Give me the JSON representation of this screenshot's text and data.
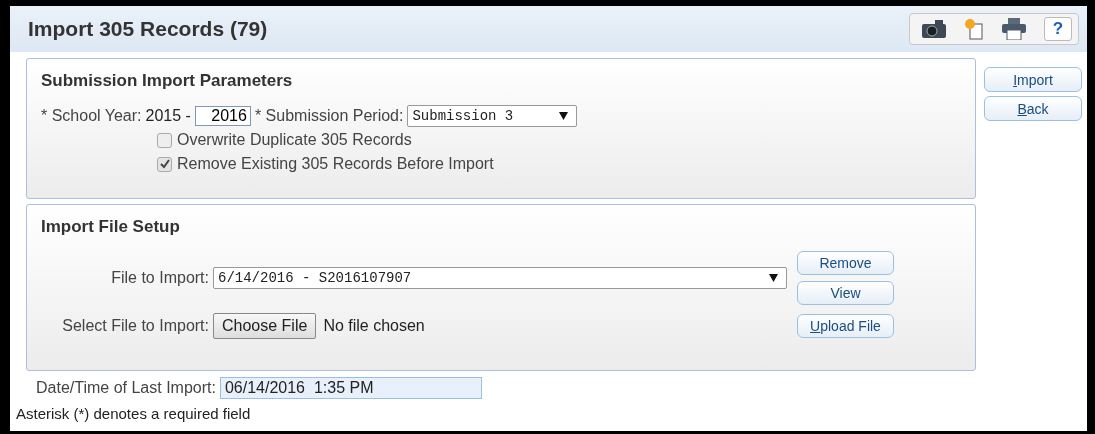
{
  "window": {
    "title": "Import 305 Records (79)"
  },
  "toolbar": [
    {
      "kind": "camera"
    },
    {
      "kind": "copy"
    },
    {
      "kind": "print"
    },
    {
      "kind": "help",
      "label": "?"
    }
  ],
  "actions": [
    {
      "label": "Import",
      "access_key": true
    },
    {
      "label": "Back",
      "access_key": true
    }
  ],
  "parameters": {
    "title": "Submission Import Parameters",
    "school_year_label": "* School Year:",
    "year_start": "2015 -",
    "year_end": "2016",
    "period_label": "* Submission Period:",
    "period_value": "Submission 3",
    "checkboxes": [
      {
        "label": "Overwrite Duplicate 305 Records",
        "checked": false
      },
      {
        "label": "Remove Existing 305 Records Before Import",
        "checked": true
      }
    ]
  },
  "file_setup": {
    "title": "Import File Setup",
    "file_label": "File to Import:",
    "file_value": "6/14/2016 - S2016107907",
    "select_label": "Select File to Import:",
    "choose_button": "Choose File",
    "no_file": "No file chosen",
    "buttons": [
      {
        "label": "Remove",
        "access_key": false
      },
      {
        "label": "View",
        "access_key": false
      },
      {
        "label": "Upload File",
        "access_key": true
      }
    ]
  },
  "last_import": {
    "label": "Date/Time of Last Import:",
    "value": "06/14/2016  1:35 PM"
  },
  "footnote": "Asterisk (*) denotes a required field"
}
